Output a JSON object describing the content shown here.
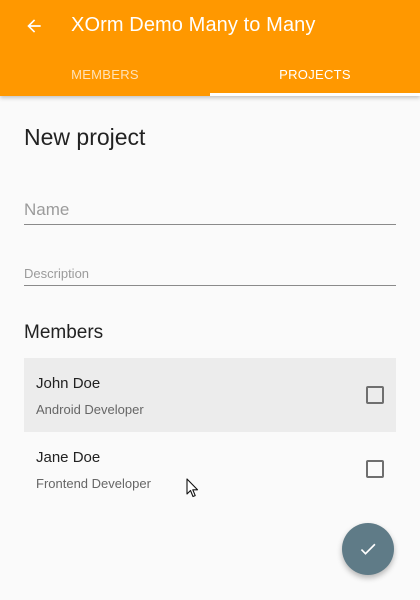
{
  "appbar": {
    "title": "XOrm Demo Many to Many",
    "back_icon": "arrow-left-icon",
    "color": "#ff9800"
  },
  "tabs": [
    {
      "label": "MEMBERS",
      "active": false
    },
    {
      "label": "PROJECTS",
      "active": true
    }
  ],
  "form": {
    "page_title": "New project",
    "name_placeholder": "Name",
    "name_value": "",
    "description_placeholder": "Description",
    "description_value": ""
  },
  "members": {
    "section_title": "Members",
    "items": [
      {
        "name": "John Doe",
        "role": "Android Developer",
        "checked": false
      },
      {
        "name": "Jane Doe",
        "role": "Frontend Developer",
        "checked": false
      }
    ]
  },
  "fab": {
    "icon": "check-icon",
    "color": "#5f7b87"
  }
}
